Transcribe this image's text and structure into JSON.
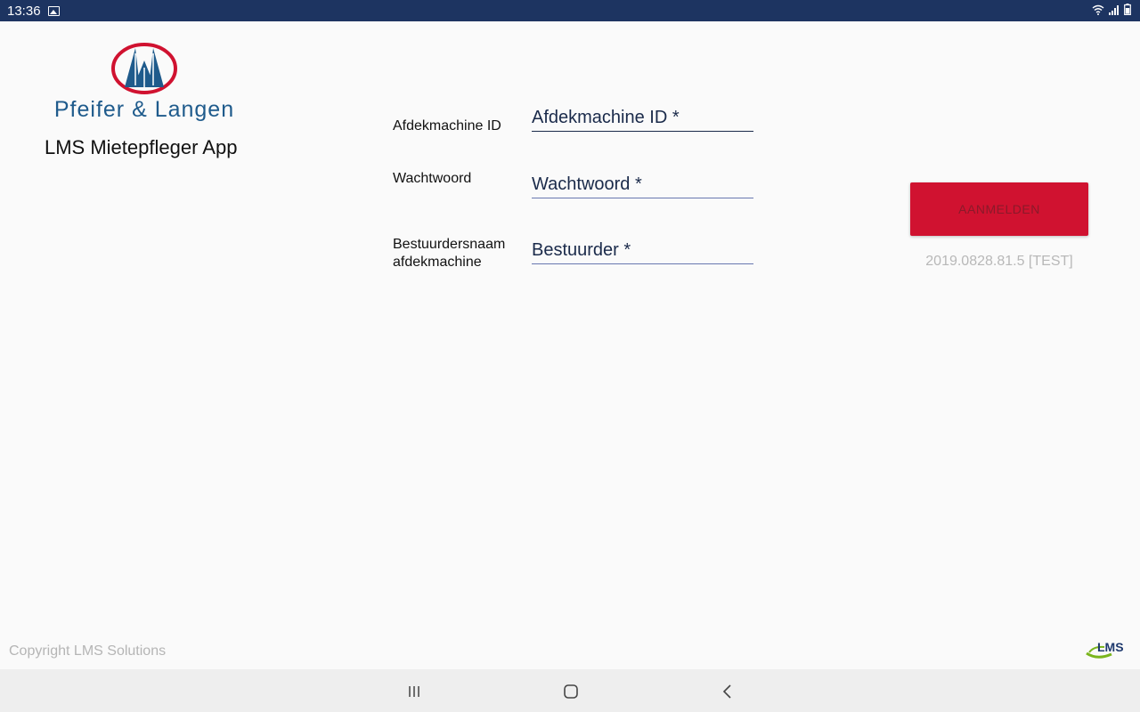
{
  "status_bar": {
    "time": "13:36",
    "icons": [
      "image-icon",
      "wifi-icon",
      "signal-icon",
      "battery-icon"
    ]
  },
  "brand": {
    "company": "Pfeifer & Langen",
    "app_title": "LMS Mietepfleger App"
  },
  "form": {
    "fields": [
      {
        "label": "Afdekmachine ID",
        "placeholder": "Afdekmachine ID *",
        "value": ""
      },
      {
        "label": "Wachtwoord",
        "placeholder": "Wachtwoord *",
        "value": ""
      },
      {
        "label": "Bestuurdersnaam afdekmachine",
        "placeholder": "Bestuurder *",
        "value": ""
      }
    ],
    "submit_label": "AANMELDEN",
    "version": "2019.0828.81.5 [TEST]"
  },
  "footer": {
    "copyright": "Copyright LMS Solutions",
    "logo_text": "LMS"
  },
  "nav_bar": {
    "buttons": [
      "recents-icon",
      "home-icon",
      "back-icon"
    ]
  },
  "colors": {
    "status_bar": "#1d3461",
    "accent_red": "#d01230",
    "brand_blue": "#1f5b8c",
    "lms_green": "#7ab51d"
  }
}
